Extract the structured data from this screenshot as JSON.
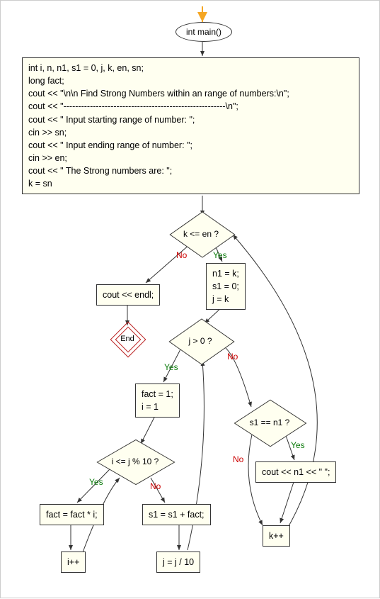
{
  "chart_data": {
    "type": "flowchart",
    "nodes": [
      {
        "id": "start",
        "shape": "ellipse",
        "label": "int main()"
      },
      {
        "id": "init",
        "shape": "rect",
        "label": "int i, n, n1, s1 = 0, j, k, en, sn;\nlong fact;\ncout << \"\\n\\n Find Strong Numbers within an range of numbers:\\n\";\ncout << \"-------------------------------------------------------\\n\";\ncout << \" Input starting range of number: \";\ncin >> sn;\ncout << \" Input ending range of number: \";\ncin >> en;\ncout << \" The Strong numbers are: \";\nk = sn"
      },
      {
        "id": "cond_outer",
        "shape": "diamond",
        "label": "k <= en ?"
      },
      {
        "id": "endl",
        "shape": "rect",
        "label": "cout << endl;"
      },
      {
        "id": "end",
        "shape": "end",
        "label": "End"
      },
      {
        "id": "assign1",
        "shape": "rect",
        "label": "n1 = k;\ns1 = 0;\nj = k"
      },
      {
        "id": "cond_j",
        "shape": "diamond",
        "label": "j > 0 ?"
      },
      {
        "id": "fact_init",
        "shape": "rect",
        "label": "fact = 1;\ni = 1"
      },
      {
        "id": "cond_i",
        "shape": "diamond",
        "label": "i <= j % 10 ?"
      },
      {
        "id": "fact_mul",
        "shape": "rect",
        "label": "fact = fact * i;"
      },
      {
        "id": "s1_add",
        "shape": "rect",
        "label": "s1 = s1 + fact;"
      },
      {
        "id": "ipp",
        "shape": "rect",
        "label": "i++"
      },
      {
        "id": "jdiv",
        "shape": "rect",
        "label": "j = j / 10"
      },
      {
        "id": "cond_s1",
        "shape": "diamond",
        "label": "s1 == n1 ?"
      },
      {
        "id": "cout_n1",
        "shape": "rect",
        "label": "cout << n1 << \" \";"
      },
      {
        "id": "kpp",
        "shape": "rect",
        "label": "k++"
      }
    ],
    "edges": [
      {
        "from": "start",
        "to": "init"
      },
      {
        "from": "init",
        "to": "cond_outer"
      },
      {
        "from": "cond_outer",
        "to": "endl",
        "label": "No",
        "color": "#c00"
      },
      {
        "from": "cond_outer",
        "to": "assign1",
        "label": "Yes",
        "color": "#0a7a0a"
      },
      {
        "from": "endl",
        "to": "end"
      },
      {
        "from": "assign1",
        "to": "cond_j"
      },
      {
        "from": "cond_j",
        "to": "fact_init",
        "label": "Yes",
        "color": "#0a7a0a"
      },
      {
        "from": "cond_j",
        "to": "cond_s1",
        "label": "No",
        "color": "#c00"
      },
      {
        "from": "fact_init",
        "to": "cond_i"
      },
      {
        "from": "cond_i",
        "to": "fact_mul",
        "label": "Yes",
        "color": "#0a7a0a"
      },
      {
        "from": "cond_i",
        "to": "s1_add",
        "label": "No",
        "color": "#c00"
      },
      {
        "from": "fact_mul",
        "to": "ipp"
      },
      {
        "from": "ipp",
        "to": "cond_i"
      },
      {
        "from": "s1_add",
        "to": "jdiv"
      },
      {
        "from": "jdiv",
        "to": "cond_j"
      },
      {
        "from": "cond_s1",
        "to": "cout_n1",
        "label": "Yes",
        "color": "#0a7a0a"
      },
      {
        "from": "cond_s1",
        "to": "kpp",
        "label": "No",
        "color": "#c00"
      },
      {
        "from": "cout_n1",
        "to": "kpp"
      },
      {
        "from": "kpp",
        "to": "cond_outer"
      }
    ]
  },
  "labels": {
    "yes": "Yes",
    "no": "No"
  }
}
